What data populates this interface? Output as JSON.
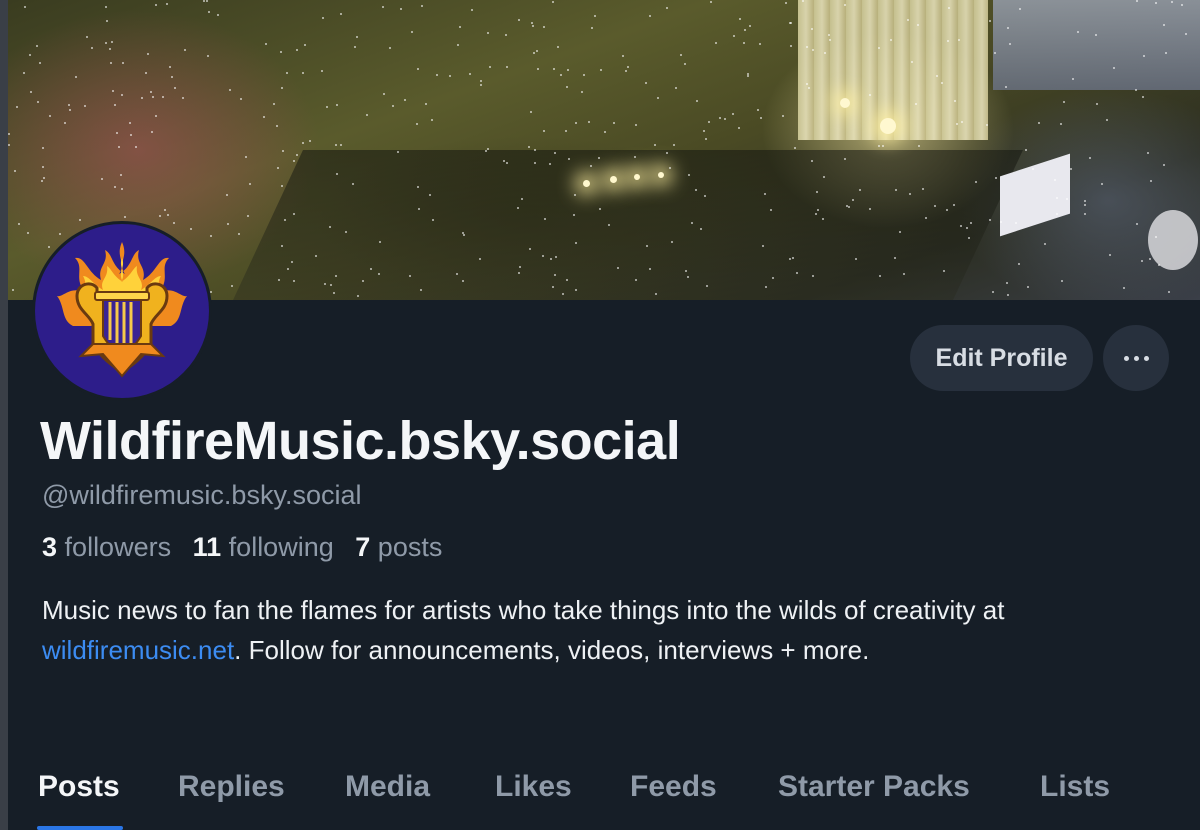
{
  "profile": {
    "display_name": "WildfireMusic.bsky.social",
    "handle": "@wildfiremusic.bsky.social",
    "stats": {
      "followers_count": "3",
      "followers_label": "followers",
      "following_count": "11",
      "following_label": "following",
      "posts_count": "7",
      "posts_label": "posts"
    },
    "bio": {
      "text_before_link": "Music news to fan the flames for artists who take things into the wilds of creativity at ",
      "link_text": "wildfiremusic.net",
      "text_after_link": ". Follow for  announcements, videos, interviews + more."
    }
  },
  "actions": {
    "edit_profile_label": "Edit Profile",
    "more_icon": "ellipsis-icon"
  },
  "tabs": [
    {
      "label": "Posts",
      "active": true
    },
    {
      "label": "Replies",
      "active": false
    },
    {
      "label": "Media",
      "active": false
    },
    {
      "label": "Likes",
      "active": false
    },
    {
      "label": "Feeds",
      "active": false
    },
    {
      "label": "Starter Packs",
      "active": false
    },
    {
      "label": "Lists",
      "active": false
    }
  ],
  "colors": {
    "background": "#161e27",
    "text_primary": "#f4f6f8",
    "text_secondary": "#8f9aa8",
    "link": "#3c8cf2",
    "button_bg": "#27303d",
    "tab_indicator": "#2a76e6",
    "avatar_bg": "#2d1d8a"
  },
  "icons": {
    "avatar_logo": "flaming-lyre-icon"
  }
}
